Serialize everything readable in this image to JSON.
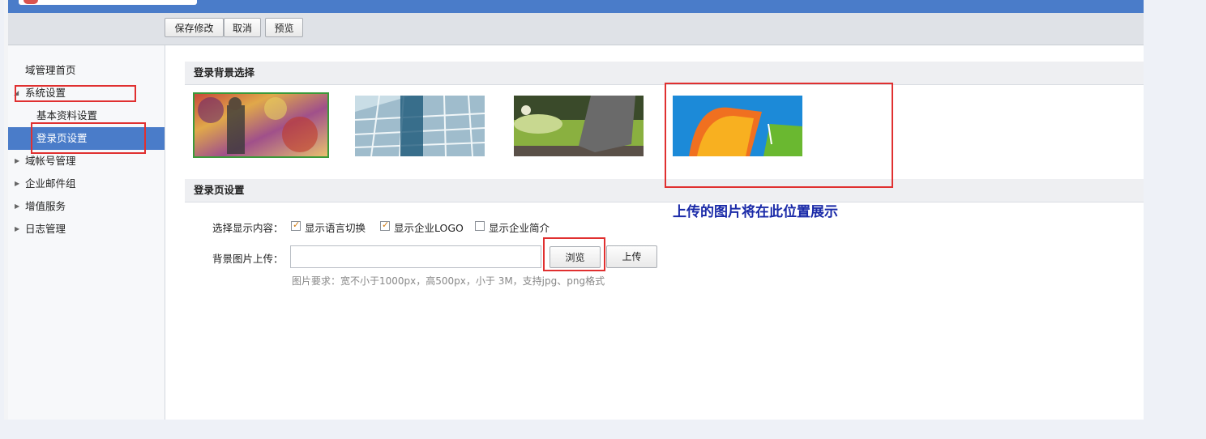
{
  "toolbar": {
    "save_label": "保存修改",
    "cancel_label": "取消",
    "preview_label": "预览"
  },
  "sidebar": {
    "items": [
      {
        "label": "域管理首页"
      },
      {
        "label": "系统设置"
      },
      {
        "label": "基本资料设置"
      },
      {
        "label": "登录页设置"
      },
      {
        "label": "域帐号管理"
      },
      {
        "label": "企业邮件组"
      },
      {
        "label": "增值服务"
      },
      {
        "label": "日志管理"
      }
    ]
  },
  "background_section": {
    "title": "登录背景选择",
    "thumbnails": [
      "graffiti-wall-photo",
      "glass-building-photo",
      "stone-foot-on-grass-photo",
      "windows-7-logo-photo"
    ],
    "selected_index": 0
  },
  "login_settings": {
    "title": "登录页设置",
    "display_label": "选择显示内容：",
    "options": [
      {
        "label": "显示语言切换",
        "checked": true
      },
      {
        "label": "显示企业LOGO",
        "checked": true
      },
      {
        "label": "显示企业简介",
        "checked": false
      }
    ],
    "upload_label": "背景图片上传：",
    "browse_label": "浏览",
    "upload_button": "上传",
    "file_value": "",
    "hint": "图片要求：宽不小于1000px，高500px，小于 3M，支持jpg、png格式"
  },
  "annotation": {
    "text": "上传的图片将在此位置展示",
    "color": "#1a2aa8"
  },
  "colors": {
    "topbar": "#4a7cc9",
    "active_nav": "#4a7cc9",
    "highlight_box": "#e03030",
    "selected_outline": "#3a9a3a"
  }
}
